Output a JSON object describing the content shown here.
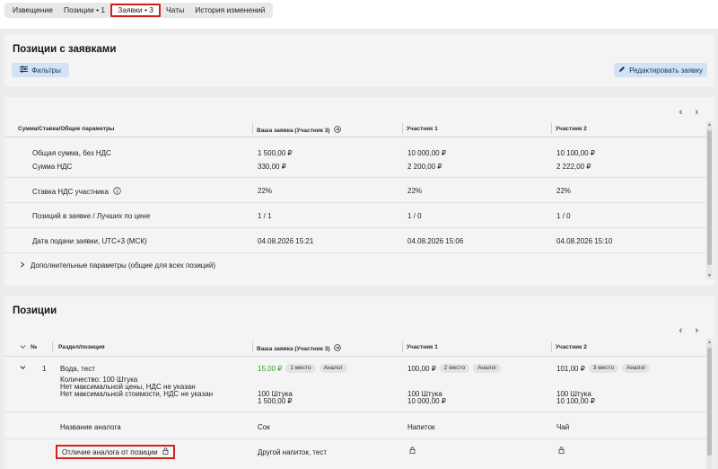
{
  "tabs": [
    "Извещение",
    "Позиции • 1",
    "Заявки • 3",
    "Чаты",
    "История изменений"
  ],
  "section1": {
    "title": "Позиции с заявками",
    "filter_label": "Фильтры",
    "edit_label": "Редактировать заявку"
  },
  "params": {
    "headers": [
      "Сумма/Ставка/Общие параметры",
      "Ваша заявка (Участник 3)",
      "Участник 1",
      "Участник 2"
    ],
    "rows": [
      {
        "label": "Общая сумма, без НДС",
        "sublabel": "Сумма НДС",
        "values": [
          "1 500,00 ₽",
          "10 000,00 ₽",
          "10 100,00 ₽"
        ],
        "subvalues": [
          "330,00 ₽",
          "2 200,00 ₽",
          "2 222,00 ₽"
        ]
      },
      {
        "label": "Ставка НДС участника",
        "values": [
          "22%",
          "22%",
          "22%"
        ]
      },
      {
        "label": "Позиций в заявке / Лучших по цене",
        "values": [
          "1 / 1",
          "1 / 0",
          "1 / 0"
        ]
      },
      {
        "label": "Дата подачи заявки, UTC+3 (МСК)",
        "values": [
          "04.08.2026 15:21",
          "04.08.2026 15:06",
          "04.08.2026 15:10"
        ]
      }
    ],
    "extra": "Дополнительные параметры (общие для всех позиций)"
  },
  "positions": {
    "title": "Позиции",
    "headers": [
      "№",
      "Раздел/позиция",
      "Ваша заявка (Участник 3)",
      "Участник 1",
      "Участник 2"
    ],
    "item": {
      "num": "1",
      "name": "Вода, тест",
      "details": [
        "Количество: 100 Штука",
        "Нет максимальной цены, НДС не указан",
        "Нет максимальной стоимости, НДС не указан"
      ],
      "bids": [
        {
          "price": "15,00 ₽",
          "place": "1 место",
          "tag": "Аналог",
          "qty": "100 Штука",
          "total": "1 500,00 ₽"
        },
        {
          "price": "100,00 ₽",
          "place": "2 место",
          "tag": "Аналог",
          "qty": "100 Штука",
          "total": "10 000,00 ₽"
        },
        {
          "price": "101,00 ₽",
          "place": "3 место",
          "tag": "Аналог",
          "qty": "100 Штука",
          "total": "10 100,00 ₽"
        }
      ]
    },
    "analog_label": "Название аналога",
    "analog_values": [
      "Сок",
      "Напиток",
      "Чай"
    ],
    "diff_label": "Отличие аналога от позиции",
    "diff_value": "Другой напиток, тест"
  },
  "colors": {
    "accent_bg": "#d3e2f4",
    "highlight": "#d62020",
    "best_price": "#3a9a2c"
  }
}
